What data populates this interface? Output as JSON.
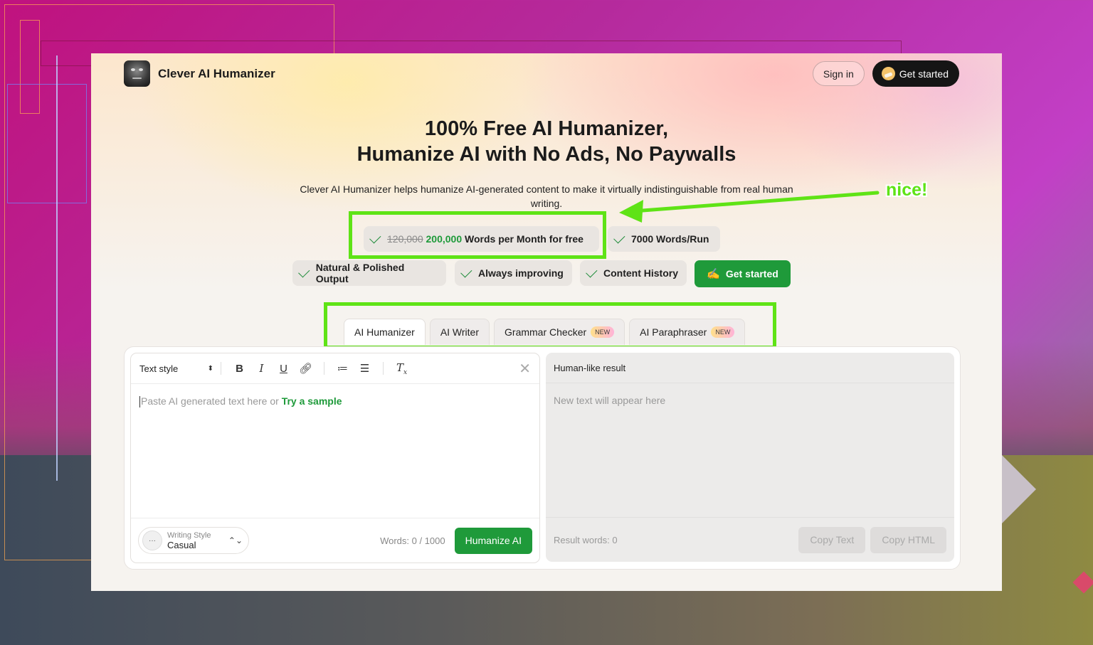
{
  "brand": {
    "name": "Clever AI Humanizer"
  },
  "nav": {
    "signin": "Sign in",
    "get_started": "Get started"
  },
  "hero": {
    "title_line1": "100% Free AI Humanizer,",
    "title_line2": "Humanize AI with No Ads, No Paywalls",
    "subtitle": "Clever AI Humanizer helps humanize AI-generated content to make it virtually indistinguishable from real human writing."
  },
  "features": {
    "words_old": "120,000",
    "words_new": "200,000",
    "words_rest": "Words per Month for free",
    "words_run": "7000 Words/Run",
    "natural": "Natural & Polished Output",
    "improving": "Always improving",
    "history": "Content History",
    "cta": "Get started"
  },
  "annotation": {
    "text": "nice!",
    "color": "#5fe316"
  },
  "tabs": [
    {
      "label": "AI Humanizer",
      "active": true
    },
    {
      "label": "AI Writer"
    },
    {
      "label": "Grammar Checker",
      "badge": "NEW"
    },
    {
      "label": "AI Paraphraser",
      "badge": "NEW"
    }
  ],
  "editor": {
    "text_style": "Text style",
    "placeholder": "Paste AI generated text here or",
    "try_sample": "Try a sample",
    "writing_style_label": "Writing Style",
    "writing_style_value": "Casual",
    "word_count": "Words: 0 / 1000",
    "humanize_btn": "Humanize AI"
  },
  "result": {
    "title": "Human-like result",
    "placeholder": "New text will appear here",
    "result_words": "Result words: 0",
    "copy_text": "Copy Text",
    "copy_html": "Copy HTML"
  },
  "colors": {
    "accent": "#1f9a3a",
    "dark": "#151515"
  }
}
